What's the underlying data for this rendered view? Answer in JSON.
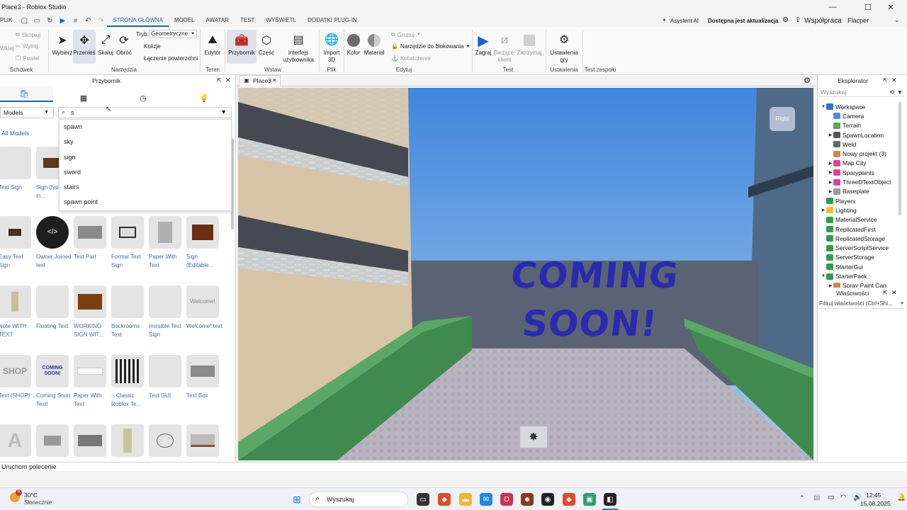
{
  "window": {
    "title": "Place3 - Roblox Studio"
  },
  "menubar": {
    "plik": "PLIK",
    "tabs": [
      "STRONA GŁÓWNA",
      "MODEL",
      "AWATAR",
      "TEST",
      "WYŚWIETL",
      "DODATKI PLUG-IN"
    ],
    "assistant": "Asystent AI",
    "update": "Dostępna jest aktualizacja",
    "collab": "Współpraca",
    "user": "Flacper"
  },
  "ribbon": {
    "clipboard": {
      "paste": "Wklej",
      "copy": "Skopiuj",
      "cut": "Wytnij",
      "duplicate": "Powiel",
      "group": "Schowek"
    },
    "tools": {
      "select": "Wybierz",
      "move": "Przenieś",
      "scale": "Skaluj",
      "rotate": "Obróć",
      "mode_label": "Tryb:",
      "mode_value": "Geometryczne",
      "collisions": "Kolizje",
      "join": "Łączenie powierzchni",
      "group": "Narzędzia"
    },
    "terrain": {
      "editor": "Edytor",
      "group": "Teren"
    },
    "insert": {
      "toolbox": "Przybornik",
      "part": "Część",
      "ui_line1": "Interfejs",
      "ui_line2": "użytkownika",
      "group": "Wstaw"
    },
    "file": {
      "import_line1": "Import",
      "import_line2": "3D",
      "group": "Plik"
    },
    "edit": {
      "color": "Kolor",
      "material": "Materiał",
      "group_btn": "Grupuj",
      "lock_tool": "Narzędzie do blokowania",
      "anchor": "Kotwiczenie",
      "group": "Edytuj"
    },
    "test": {
      "play": "Zagraj",
      "current_line1": "Bieżące:",
      "current_line2": "klient",
      "stop": "Zatrzymaj",
      "group": "Test"
    },
    "settings": {
      "game_line1": "Ustawienia",
      "game_line2": "gry",
      "group": "Ustawienia"
    },
    "team_test": {
      "group": "Test zespołu"
    }
  },
  "toolbox": {
    "title": "Przybornik",
    "category": "Models",
    "search_value": "s",
    "all_models": "All Models",
    "suggestions": [
      "spawn",
      "sky",
      "sign",
      "sword",
      "stairs",
      "spawn point"
    ],
    "items": [
      {
        "label": "Text Sign",
        "thumb": ""
      },
      {
        "label": "Sign (type text in...",
        "thumb": ""
      },
      {
        "label": "Easy Text Sign",
        "thumb": ""
      },
      {
        "label": "Owner Joined text",
        "thumb": "</>"
      },
      {
        "label": "Text Part",
        "thumb": ""
      },
      {
        "label": "Formal Text Sign",
        "thumb": ""
      },
      {
        "label": "Paper With Text",
        "thumb": ""
      },
      {
        "label": "Sign (Editable...",
        "thumb": ""
      },
      {
        "label": "Note WITH TEXT",
        "thumb": ""
      },
      {
        "label": "Floating Text",
        "thumb": ""
      },
      {
        "label": "WORKING SIGN WIT...",
        "thumb": ""
      },
      {
        "label": "Backrooms Text",
        "thumb": ""
      },
      {
        "label": "Invisible Text Sign",
        "thumb": ""
      },
      {
        "label": "Welcome! text",
        "thumb": "Welcome!"
      },
      {
        "label": "Text [SHOP]",
        "thumb": "SHOP"
      },
      {
        "label": "Coming Soon Text!",
        "thumb": "COMING SOON!"
      },
      {
        "label": "Paper With Text",
        "thumb": ""
      },
      {
        "label": "~ Classic Roblox Te...",
        "thumb": ""
      },
      {
        "label": "Text GUI",
        "thumb": ""
      },
      {
        "label": "Text Box",
        "thumb": ""
      },
      {
        "label": "",
        "thumb": "A"
      },
      {
        "label": "",
        "thumb": ""
      },
      {
        "label": "",
        "thumb": ""
      },
      {
        "label": "",
        "thumb": ""
      },
      {
        "label": "",
        "thumb": ""
      },
      {
        "label": "",
        "thumb": ""
      }
    ]
  },
  "viewport": {
    "tab": "Place3",
    "view_cube": "Right",
    "sign_line1": "COMING",
    "sign_line2": "SOON!"
  },
  "explorer": {
    "title": "Eksplorator",
    "search_placeholder": "Wyszukaj",
    "items": [
      "Workspace",
      "Camera",
      "Terrain",
      "SpawnLocation",
      "Weld",
      "Nowy projekt (3)",
      "Map City",
      "Sparypaints",
      "ThreeDTextObject",
      "Baseplate",
      "Players",
      "Lighting",
      "MaterialService",
      "ReplicatedFirst",
      "ReplicatedStorage",
      "ServerScriptService",
      "ServerStorage",
      "StarterGui",
      "StarterPack",
      "Spray Paint Can"
    ],
    "colors": [
      "#2f6fd6",
      "#4a90d9",
      "#4caf50",
      "#555555",
      "#666666",
      "#cc8844",
      "#e0409a",
      "#e0409a",
      "#e0409a",
      "#999999",
      "#2e9e4a",
      "#f0c020",
      "#2e9e4a",
      "#2e9e4a",
      "#2e9e4a",
      "#2e9e4a",
      "#2e9e4a",
      "#2e9e4a",
      "#2e9e4a",
      "#cc8844"
    ]
  },
  "properties": {
    "title": "Właściwości",
    "filter_placeholder": "Filtruj właściwości (Ctrl+Shi..."
  },
  "command_bar": {
    "placeholder": "Uruchom polecenie"
  },
  "taskbar": {
    "weather_temp": "30°C",
    "weather_desc": "Słonecznie",
    "weather_badge": "9",
    "search_label": "Wyszukaj",
    "time": "12:45",
    "date": "15.08.2025"
  }
}
